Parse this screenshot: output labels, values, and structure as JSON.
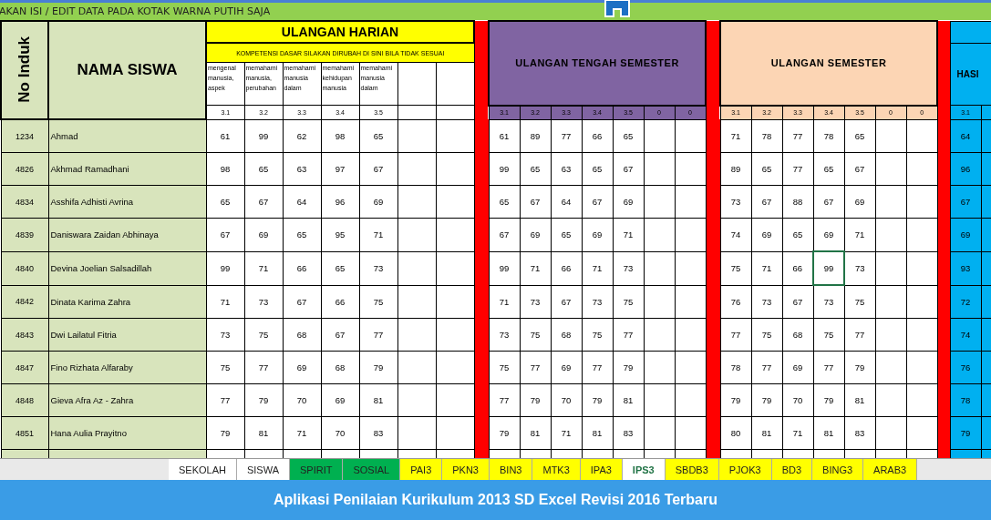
{
  "instruction_bar": {
    "text": "AKAN ISI / EDIT DATA PADA KOTAK WARNA PUTIH SAJA"
  },
  "table": {
    "no_induk": "No Induk",
    "nama": "NAMA SISWA",
    "ulangan_harian": {
      "title": "ULANGAN HARIAN",
      "subtitle": "KOMPETENSI DASAR SILAKAN DIRUBAH DI SINI BILA TIDAK SESUAI",
      "descriptions": [
        "mengenal manusia, aspek",
        "memahami manusia, perubahan",
        "memahami manusia dalam",
        "memahami kehidupan manusia",
        "memahami manusia dalam"
      ],
      "codes": [
        "3.1",
        "3.2",
        "3.3",
        "3.4",
        "3.5"
      ]
    },
    "ulangan_tengah_semester": {
      "title": "ULANGAN TENGAH SEMESTER",
      "codes": [
        "3.1",
        "3.2",
        "3.3",
        "3.4",
        "3.5",
        "0",
        "0"
      ]
    },
    "ulangan_semester": {
      "title": "ULANGAN SEMESTER",
      "codes": [
        "3.1",
        "3.2",
        "3.3",
        "3.4",
        "3.5",
        "0",
        "0"
      ]
    },
    "hasil": {
      "title": "HASI",
      "codes": [
        "3.1"
      ]
    },
    "rows": [
      {
        "no": "1234",
        "nama": "Ahmad",
        "uh": [
          "61",
          "99",
          "62",
          "98",
          "65"
        ],
        "uts": [
          "61",
          "89",
          "77",
          "66",
          "65"
        ],
        "uas": [
          {
            "value": "71",
            "selected": false
          },
          {
            "value": "78",
            "selected": false
          },
          {
            "value": "77",
            "selected": false
          },
          {
            "value": "78",
            "selected": false
          },
          {
            "value": "65",
            "selected": false
          }
        ],
        "hasil": "64"
      },
      {
        "no": "4826",
        "nama": "Akhmad Ramadhani",
        "uh": [
          "98",
          "65",
          "63",
          "97",
          "67"
        ],
        "uts": [
          "99",
          "65",
          "63",
          "65",
          "67"
        ],
        "uas": [
          {
            "value": "89",
            "selected": false
          },
          {
            "value": "65",
            "selected": false
          },
          {
            "value": "77",
            "selected": false
          },
          {
            "value": "65",
            "selected": false
          },
          {
            "value": "67",
            "selected": false
          }
        ],
        "hasil": "96"
      },
      {
        "no": "4834",
        "nama": "Asshifa Adhisti Avrina",
        "uh": [
          "65",
          "67",
          "64",
          "96",
          "69"
        ],
        "uts": [
          "65",
          "67",
          "64",
          "67",
          "69"
        ],
        "uas": [
          {
            "value": "73",
            "selected": false
          },
          {
            "value": "67",
            "selected": false
          },
          {
            "value": "88",
            "selected": false
          },
          {
            "value": "67",
            "selected": false
          },
          {
            "value": "69",
            "selected": false
          }
        ],
        "hasil": "67"
      },
      {
        "no": "4839",
        "nama": "Daniswara Zaidan Abhinaya",
        "uh": [
          "67",
          "69",
          "65",
          "95",
          "71"
        ],
        "uts": [
          "67",
          "69",
          "65",
          "69",
          "71"
        ],
        "uas": [
          {
            "value": "74",
            "selected": false
          },
          {
            "value": "69",
            "selected": false
          },
          {
            "value": "65",
            "selected": false
          },
          {
            "value": "69",
            "selected": false
          },
          {
            "value": "71",
            "selected": false
          }
        ],
        "hasil": "69"
      },
      {
        "no": "4840",
        "nama": "Devina Joelian Salsadillah",
        "uh": [
          "99",
          "71",
          "66",
          "65",
          "73"
        ],
        "uts": [
          "99",
          "71",
          "66",
          "71",
          "73"
        ],
        "uas": [
          {
            "value": "75",
            "selected": false
          },
          {
            "value": "71",
            "selected": false
          },
          {
            "value": "66",
            "selected": false
          },
          {
            "value": "99",
            "selected": true
          },
          {
            "value": "73",
            "selected": false
          }
        ],
        "hasil": "93"
      },
      {
        "no": "4842",
        "nama": "Dinata Karima Zahra",
        "uh": [
          "71",
          "73",
          "67",
          "66",
          "75"
        ],
        "uts": [
          "71",
          "73",
          "67",
          "73",
          "75"
        ],
        "uas": [
          {
            "value": "76",
            "selected": false
          },
          {
            "value": "73",
            "selected": false
          },
          {
            "value": "67",
            "selected": false
          },
          {
            "value": "73",
            "selected": false
          },
          {
            "value": "75",
            "selected": false
          }
        ],
        "hasil": "72"
      },
      {
        "no": "4843",
        "nama": "Dwi Lailatul Fitria",
        "uh": [
          "73",
          "75",
          "68",
          "67",
          "77"
        ],
        "uts": [
          "73",
          "75",
          "68",
          "75",
          "77"
        ],
        "uas": [
          {
            "value": "77",
            "selected": false
          },
          {
            "value": "75",
            "selected": false
          },
          {
            "value": "68",
            "selected": false
          },
          {
            "value": "75",
            "selected": false
          },
          {
            "value": "77",
            "selected": false
          }
        ],
        "hasil": "74"
      },
      {
        "no": "4847",
        "nama": "Fino Rizhata Alfaraby",
        "uh": [
          "75",
          "77",
          "69",
          "68",
          "79"
        ],
        "uts": [
          "75",
          "77",
          "69",
          "77",
          "79"
        ],
        "uas": [
          {
            "value": "78",
            "selected": false
          },
          {
            "value": "77",
            "selected": false
          },
          {
            "value": "69",
            "selected": false
          },
          {
            "value": "77",
            "selected": false
          },
          {
            "value": "79",
            "selected": false
          }
        ],
        "hasil": "76"
      },
      {
        "no": "4848",
        "nama": "Gieva Afra Az - Zahra",
        "uh": [
          "77",
          "79",
          "70",
          "69",
          "81"
        ],
        "uts": [
          "77",
          "79",
          "70",
          "79",
          "81"
        ],
        "uas": [
          {
            "value": "79",
            "selected": false
          },
          {
            "value": "79",
            "selected": false
          },
          {
            "value": "70",
            "selected": false
          },
          {
            "value": "79",
            "selected": false
          },
          {
            "value": "81",
            "selected": false
          }
        ],
        "hasil": "78"
      },
      {
        "no": "4851",
        "nama": "Hana Aulia Prayitno",
        "uh": [
          "79",
          "81",
          "71",
          "70",
          "83"
        ],
        "uts": [
          "79",
          "81",
          "71",
          "81",
          "83"
        ],
        "uas": [
          {
            "value": "80",
            "selected": false
          },
          {
            "value": "81",
            "selected": false
          },
          {
            "value": "71",
            "selected": false
          },
          {
            "value": "81",
            "selected": false
          },
          {
            "value": "83",
            "selected": false
          }
        ],
        "hasil": "79"
      }
    ]
  },
  "sheet_tabs": [
    {
      "label": "SEKOLAH",
      "color": "#ffffff",
      "selected": false
    },
    {
      "label": "SISWA",
      "color": "#ffffff",
      "selected": false
    },
    {
      "label": "SPIRIT",
      "color": "#00b050",
      "selected": false
    },
    {
      "label": "SOSIAL",
      "color": "#00b050",
      "selected": false
    },
    {
      "label": "PAI3",
      "color": "#ffff00",
      "selected": false
    },
    {
      "label": "PKN3",
      "color": "#ffff00",
      "selected": false
    },
    {
      "label": "BIN3",
      "color": "#ffff00",
      "selected": false
    },
    {
      "label": "MTK3",
      "color": "#ffff00",
      "selected": false
    },
    {
      "label": "IPA3",
      "color": "#ffff00",
      "selected": false
    },
    {
      "label": "IPS3",
      "color": "#ffffff",
      "selected": true
    },
    {
      "label": "SBDB3",
      "color": "#ffff00",
      "selected": false
    },
    {
      "label": "PJOK3",
      "color": "#ffff00",
      "selected": false
    },
    {
      "label": "BD3",
      "color": "#ffff00",
      "selected": false
    },
    {
      "label": "BING3",
      "color": "#ffff00",
      "selected": false
    },
    {
      "label": "ARAB3",
      "color": "#ffff00",
      "selected": false
    }
  ],
  "banner": {
    "text": "Aplikasi Penilaian Kurikulum 2013 SD Excel Revisi 2016 Terbaru"
  }
}
